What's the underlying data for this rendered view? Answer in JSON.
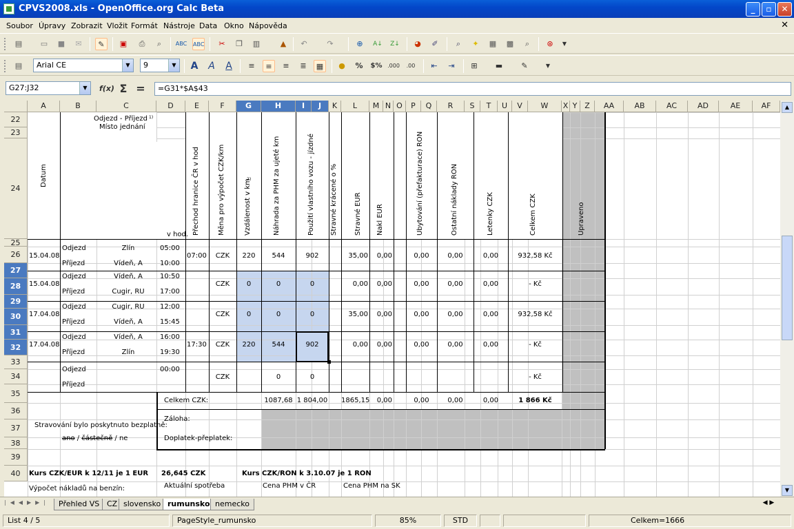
{
  "window": {
    "title": "CPVS2008.xls - OpenOffice.org Calc Beta"
  },
  "menu": [
    "Soubor",
    "Úpravy",
    "Zobrazit",
    "Vložit",
    "Formát",
    "Nástroje",
    "Data",
    "Okno",
    "Nápověda"
  ],
  "format_toolbar": {
    "font": "Arial CE",
    "size": "9"
  },
  "formula_bar": {
    "name_box": "G27:J32",
    "formula": "=G31*$A$43"
  },
  "columns": [
    "A",
    "B",
    "C",
    "D",
    "E",
    "F",
    "G",
    "H",
    "I",
    "J",
    "K",
    "L",
    "M",
    "N",
    "O",
    "P",
    "Q",
    "R",
    "S",
    "T",
    "U",
    "V",
    "W",
    "X",
    "Y",
    "Z",
    "AA",
    "AB",
    "AC",
    "AD",
    "AE",
    "AF"
  ],
  "rows": [
    "22",
    "23",
    "24",
    "25",
    "26",
    "27",
    "28",
    "29",
    "30",
    "31",
    "32",
    "33",
    "34",
    "35",
    "36",
    "37",
    "38",
    "39",
    "40"
  ],
  "headers": {
    "odjezd_prijezd": "Odjezd - Příjezd",
    "superscript": "1)",
    "misto": "Místo jednání",
    "v_hod": "v hod.",
    "datum": "Datum",
    "prechod": "Přechod hranice ČR v hod",
    "mena": "Měna pro výpočet CZK/km",
    "vzdalenost": "Vzdálenost v km",
    "vzdalenost_sup": "2)",
    "nahrada": "Náhrada za PHM za ujeté km",
    "pouziti": "Použití vlastního vozu - jízdné",
    "stravne_kracene": "Stravné krácené o %",
    "stravne_eur": "Stravné EUR",
    "nakl_eur": "Nakl EUR",
    "ubytovani": "Ubytování (přefakturace) RON",
    "ostatni": "Ostatní náklady RON",
    "letenky": "Letenky CZK",
    "celkem": "Celkem CZK",
    "upraveno": "Upraveno"
  },
  "trips": [
    {
      "date": "15.04.08",
      "odjezd_place": "Zlín",
      "odjezd_time": "05:00",
      "prijezd_place": "Vídeň, A",
      "prijezd_time": "10:00",
      "prechod": "07:00",
      "mena": "CZK",
      "km": "220",
      "nahrada": "544",
      "pouziti": "902",
      "stravne_eur": "35,00",
      "nakl_eur": "0,00",
      "ubyt": "0,00",
      "ostatni": "0,00",
      "letenky": "0,00",
      "celkem": "932,58 Kč"
    },
    {
      "date": "15.04.08",
      "odjezd_place": "Vídeň, A",
      "odjezd_time": "10:50",
      "prijezd_place": "Cugir, RU",
      "prijezd_time": "17:00",
      "prechod": "",
      "mena": "CZK",
      "km": "0",
      "nahrada": "0",
      "pouziti": "0",
      "stravne_eur": "0,00",
      "nakl_eur": "0,00",
      "ubyt": "0,00",
      "ostatni": "0,00",
      "letenky": "0,00",
      "celkem": "-   Kč"
    },
    {
      "date": "17.04.08",
      "odjezd_place": "Cugir, RU",
      "odjezd_time": "12:00",
      "prijezd_place": "Vídeň, A",
      "prijezd_time": "15:45",
      "prechod": "",
      "mena": "CZK",
      "km": "0",
      "nahrada": "0",
      "pouziti": "0",
      "stravne_eur": "35,00",
      "nakl_eur": "0,00",
      "ubyt": "0,00",
      "ostatni": "0,00",
      "letenky": "0,00",
      "celkem": "932,58 Kč"
    },
    {
      "date": "17.04.08",
      "odjezd_place": "Vídeň, A",
      "odjezd_time": "16:00",
      "prijezd_place": "Zlín",
      "prijezd_time": "19:30",
      "prechod": "17:30",
      "mena": "CZK",
      "km": "220",
      "nahrada": "544",
      "pouziti": "902",
      "stravne_eur": "0,00",
      "nakl_eur": "0,00",
      "ubyt": "0,00",
      "ostatni": "0,00",
      "letenky": "0,00",
      "celkem": "-   Kč"
    }
  ],
  "empty_trip": {
    "odjezd": "Odjezd",
    "prijezd": "Příjezd",
    "time": "00:00",
    "mena": "CZK",
    "nahrada": "0",
    "pouziti": "0",
    "celkem": "-   Kč"
  },
  "labels": {
    "odjezd": "Odjezd",
    "prijezd": "Příjezd"
  },
  "totals": {
    "label": "Celkem CZK:",
    "nahrada": "1087,68",
    "pouziti": "1 804,00",
    "stravne": "1865,15",
    "nakl": "0,00",
    "ubyt": "0,00",
    "ostatni": "0,00",
    "letenky": "0,00",
    "celkem": "1 866 Kč"
  },
  "zaloha": "Záloha:",
  "doplatek": "Doplatek-přeplatek:",
  "stravovani": "Stravování bylo poskytnuto bezplatně:",
  "stravovani_opts": {
    "a": "ano",
    "sep1": " / ",
    "b": "částečně",
    "sep2": " / ne"
  },
  "kurs_eur": "Kurs CZK/EUR k 12/11 je 1 EUR",
  "kurs_eur_val": "26,645 CZK",
  "kurs_ron": "Kurs CZK/RON k 3.10.07 je 1 RON",
  "row40": {
    "a": "Výpočet nákladů na benzín:",
    "b": "Aktuální spotřeba",
    "c": "Cena PHM v ČR",
    "d": "Cena PHM na SK"
  },
  "sheet_tabs": [
    "Přehled VS",
    "CZ",
    "slovensko",
    "rumunsko",
    "nemecko"
  ],
  "active_tab": "rumunsko",
  "status": {
    "sheet": "List 4 / 5",
    "style": "PageStyle_rumunsko",
    "zoom": "85%",
    "mode": "STD",
    "sum": "Celkem=1666"
  }
}
